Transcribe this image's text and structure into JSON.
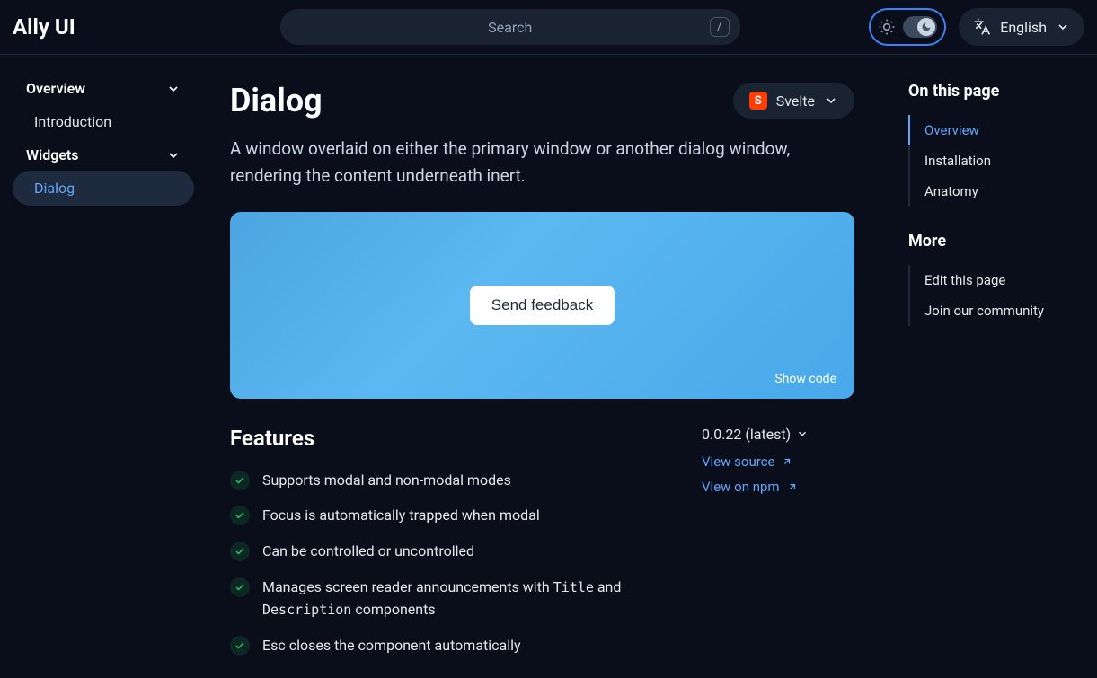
{
  "header": {
    "logo": "Ally UI",
    "search_placeholder": "Search",
    "search_shortcut": "/",
    "language": "English"
  },
  "sidebar": {
    "sections": [
      {
        "label": "Overview",
        "items": [
          {
            "label": "Introduction",
            "active": false
          }
        ]
      },
      {
        "label": "Widgets",
        "items": [
          {
            "label": "Dialog",
            "active": true
          }
        ]
      }
    ]
  },
  "page": {
    "title": "Dialog",
    "framework": "Svelte",
    "description": "A window overlaid on either the primary window or another dialog window, rendering the content underneath inert.",
    "demo_button": "Send feedback",
    "show_code": "Show code"
  },
  "features": {
    "heading": "Features",
    "items": [
      "Supports modal and non-modal modes",
      "Focus is automatically trapped when modal",
      "Can be controlled or uncontrolled",
      "Manages screen reader announcements with |Title| and |Description| components",
      "Esc closes the component automatically"
    ]
  },
  "meta": {
    "version": "0.0.22 (latest)",
    "view_source": "View source",
    "view_npm": "View on npm"
  },
  "toc": {
    "heading1": "On this page",
    "items1": [
      "Overview",
      "Installation",
      "Anatomy"
    ],
    "active1": 0,
    "heading2": "More",
    "items2": [
      "Edit this page",
      "Join our community"
    ]
  }
}
